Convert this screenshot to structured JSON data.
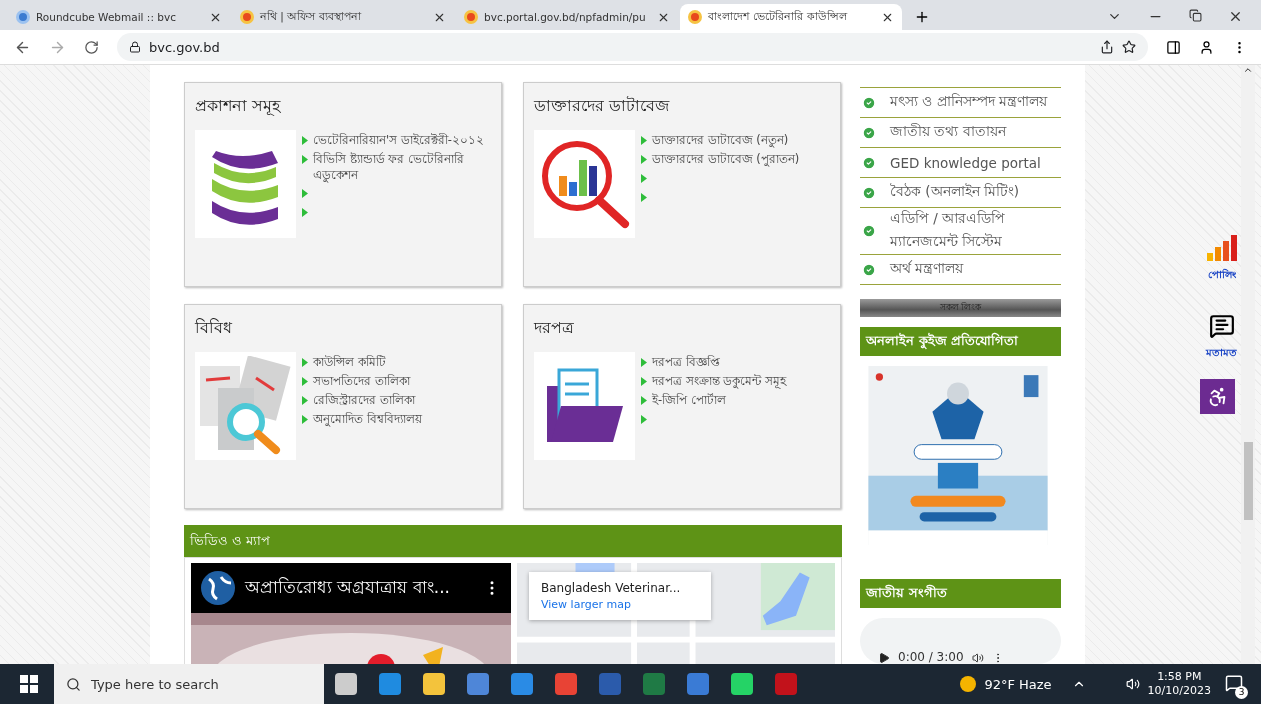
{
  "browser": {
    "tabs": [
      {
        "title": "Roundcube Webmail :: bvc",
        "selected": false
      },
      {
        "title": "নথি | অফিস ব্যবস্থাপনা",
        "selected": false
      },
      {
        "title": "bvc.portal.gov.bd/npfadmin/pu",
        "selected": false
      },
      {
        "title": "বাংলাদেশ ভেটেরিনারি কাউন্সিল",
        "selected": true
      }
    ],
    "address": "bvc.gov.bd"
  },
  "cards": [
    {
      "title": "প্রকাশনা সমূহ",
      "items": [
        {
          "kind": "link",
          "label": "ভেটেরিনারিয়ান'স ডাইরেক্টরী-২০১২"
        },
        {
          "kind": "link",
          "label": "বিভিসি ষ্ট্যান্ডার্ড ফর ভেটেরিনারি এডুকেশন"
        },
        {
          "kind": "empty"
        },
        {
          "kind": "empty"
        }
      ]
    },
    {
      "title": "ডাক্তারদের ডাটাবেজ",
      "items": [
        {
          "kind": "link",
          "label": "ডাক্তারদের ডাটাবেজ (নতুন)"
        },
        {
          "kind": "link",
          "label": "ডাক্তারদের ডাটাবেজ (পুরাতন)"
        },
        {
          "kind": "empty"
        },
        {
          "kind": "empty"
        }
      ]
    },
    {
      "title": "বিবিধ",
      "items": [
        {
          "kind": "link",
          "label": "কাউন্সিল কমিটি"
        },
        {
          "kind": "link",
          "label": "সভাপতিদের তালিকা"
        },
        {
          "kind": "link",
          "label": "রেজিস্ট্রারদের তালিকা"
        },
        {
          "kind": "link",
          "label": "অনুমোদিত বিশ্ববিদ্যালয়"
        }
      ]
    },
    {
      "title": "দরপত্র",
      "items": [
        {
          "kind": "link",
          "label": "দরপত্র বিজ্ঞপ্তি"
        },
        {
          "kind": "link",
          "label": "দরপত্র সংক্রান্ত ডকুমেন্ট সমূহ"
        },
        {
          "kind": "link",
          "label": "ই-জিপি পোর্টাল"
        },
        {
          "kind": "empty"
        }
      ]
    }
  ],
  "media": {
    "title": "ভিডিও ও ম্যাপ",
    "video_title": "অপ্রাতিরোধ্য অগ্রযাত্রায় বাং...",
    "map_place": "Bangladesh Veterinar...",
    "map_link": "View larger map"
  },
  "sidebar": {
    "links": [
      "মৎস্য ও প্রানিসম্পদ মন্ত্রণালয়",
      "জাতীয় তথ্য বাতায়ন",
      "GED knowledge portal",
      "বৈঠক (অনলাইন মিটিং)",
      "এডিপি / আরএডিপি ম্যানেজমেন্ট সিস্টেম",
      "অর্থ মন্ত্রণালয়"
    ],
    "all_links": "সকল লিংক",
    "quiz_title": "অনলাইন কুইজ প্রতিযোগিতা",
    "anthem_title": "জাতীয় সংগীত",
    "audio_time": "0:00 / 3:00"
  },
  "floating": {
    "poll": "পোলিং",
    "feedback": "মতামত"
  },
  "taskbar": {
    "search": "Type here to search",
    "weather": "92°F Haze",
    "time": "1:58 PM",
    "date": "10/10/2023",
    "notifications": "3"
  }
}
